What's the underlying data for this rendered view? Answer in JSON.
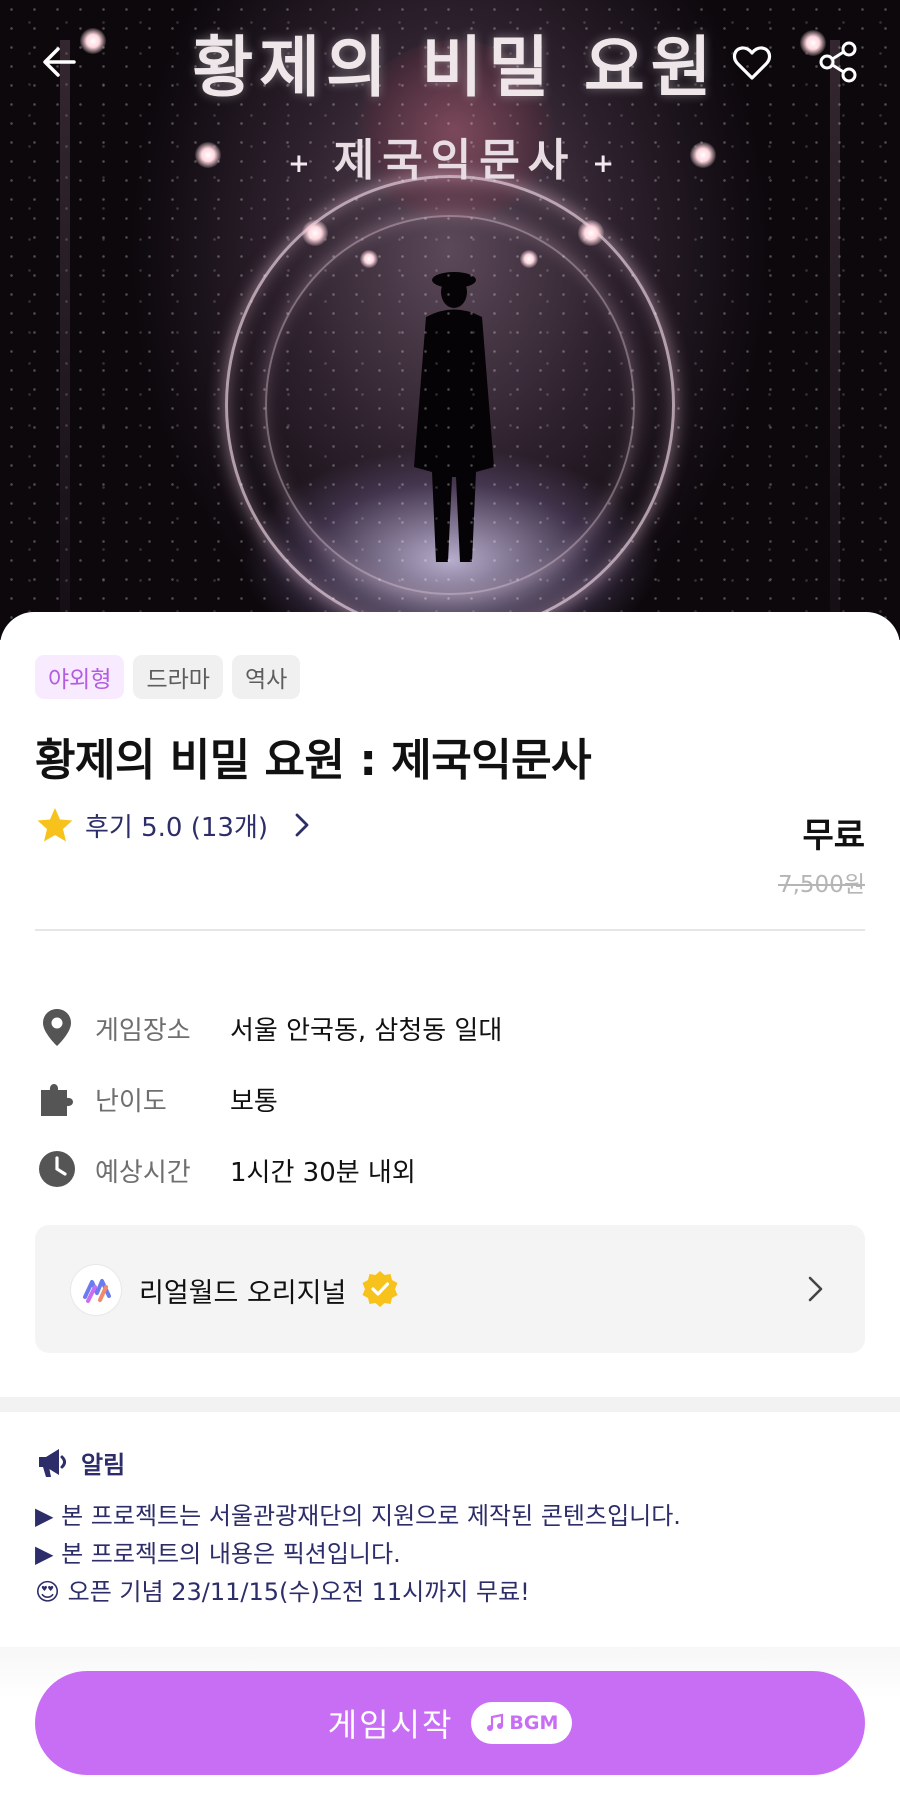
{
  "hero": {
    "title_art": "황제의 비밀 요원",
    "subtitle_art": "제국익문사",
    "subtitle_deco": "+"
  },
  "header": {
    "back_icon": "arrow-left-icon",
    "like_icon": "heart-outline-icon",
    "share_icon": "share-icon"
  },
  "tags": [
    "야외형",
    "드라마",
    "역사"
  ],
  "game": {
    "title": "황제의 비밀 요원 : 제국익문사",
    "rating_label": "후기 5.0 (13개)",
    "price": "무료",
    "original_price": "7,500원"
  },
  "info": [
    {
      "icon": "location-pin-icon",
      "key": "게임장소",
      "value": "서울 안국동, 삼청동 일대"
    },
    {
      "icon": "puzzle-piece-icon",
      "key": "난이도",
      "value": "보통"
    },
    {
      "icon": "clock-icon",
      "key": "예상시간",
      "value": "1시간 30분 내외"
    }
  ],
  "creator": {
    "name": "리얼월드 오리지널",
    "verified_icon": "verified-badge-icon"
  },
  "notice": {
    "heading": "알림",
    "lines": [
      "▶ 본 프로젝트는 서울관광재단의 지원으로 제작된 콘텐츠입니다.",
      "▶ 본 프로젝트의 내용은 픽션입니다.",
      "😍 오픈 기념 23/11/15(수)오전 11시까지 무료!"
    ]
  },
  "cta": {
    "label": "게임시작",
    "bgm_label": "BGM"
  },
  "colors": {
    "accent": "#c86ef4",
    "tag_accent_bg": "#f8ebff",
    "navy_text": "#2d2d69",
    "star": "#f7c21b",
    "verified": "#f7c21b"
  }
}
